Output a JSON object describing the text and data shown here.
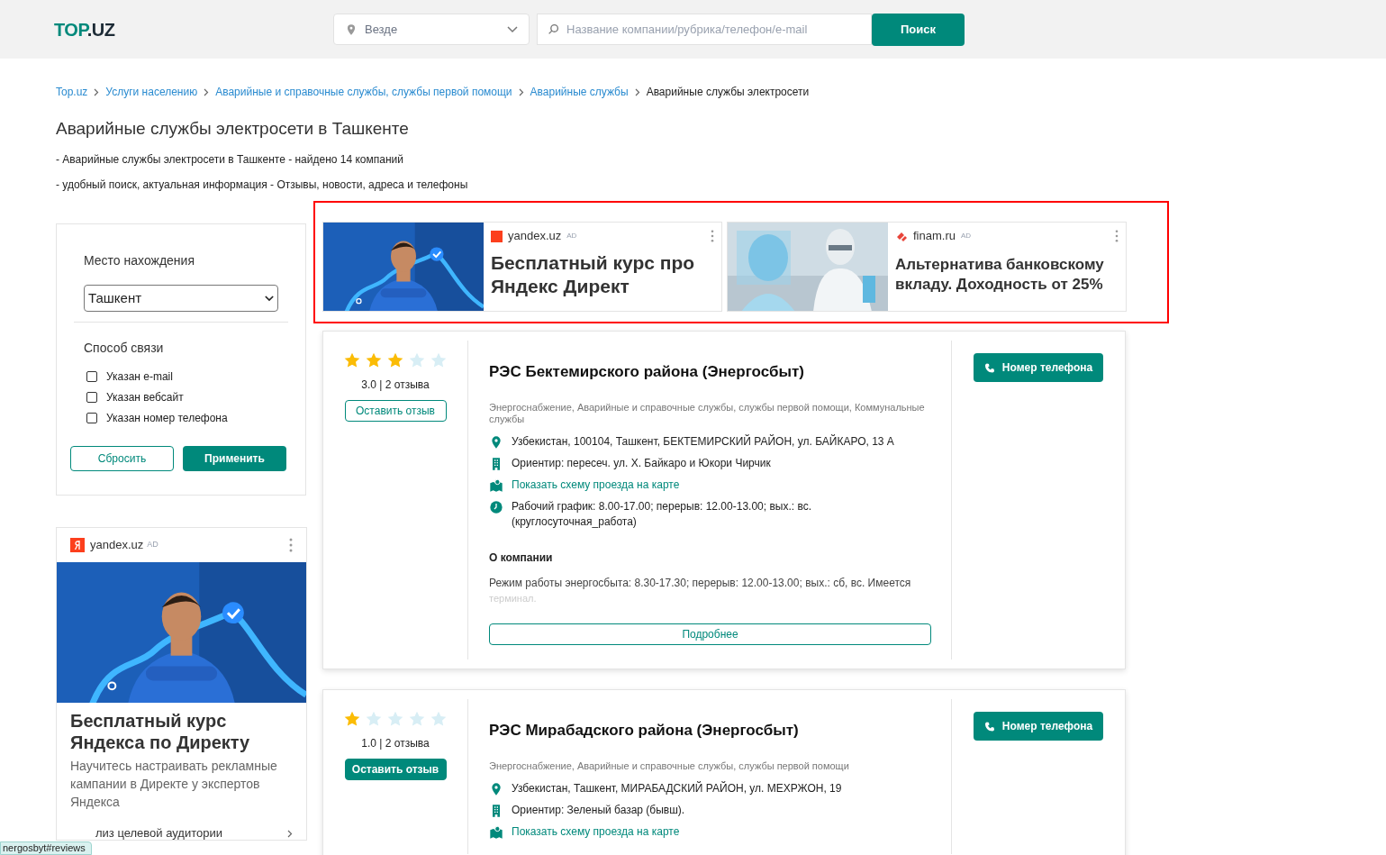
{
  "header": {
    "logo": {
      "main": "TOP",
      "accent": ".UZ"
    },
    "location": {
      "value": "Везде"
    },
    "search": {
      "placeholder": "Название компании/рубрика/телефон/e-mail"
    },
    "search_button": "Поиск"
  },
  "breadcrumbs": [
    {
      "label": "Top.uz",
      "current": false
    },
    {
      "label": "Услуги населению",
      "current": false
    },
    {
      "label": "Аварийные и справочные службы, службы первой помощи",
      "current": false
    },
    {
      "label": "Аварийные службы",
      "current": false
    },
    {
      "label": "Аварийные службы электросети",
      "current": true
    }
  ],
  "page_title": "Аварийные службы электросети в Ташкенте",
  "intro": [
    "- Аварийные службы электросети в Ташкенте - найдено 14 компаний",
    "- удобный поиск, актуальная информация - Отзывы, новости, адреса и телефоны"
  ],
  "filter": {
    "location_label": "Место нахождения",
    "location_value": "Ташкент",
    "contact_label": "Способ связи",
    "options": [
      {
        "label": "Указан e-mail",
        "checked": false
      },
      {
        "label": "Указан вебсайт",
        "checked": false
      },
      {
        "label": "Указан номер телефона",
        "checked": false
      }
    ],
    "reset": "Сбросить",
    "apply": "Применить"
  },
  "side_ad": {
    "source": "yandex.uz",
    "ad": "AD",
    "title": "Бесплатный курс Яндекса по Директу",
    "text": "Научитесь настраивать рекламные кампании в Директе у экспертов Яндекса",
    "link": "лиз целевой аудитории"
  },
  "top_ads": [
    {
      "source": "yandex.uz",
      "ad": "AD",
      "title": "Бесплатный курс про Яндекс Директ",
      "kind": "yandex"
    },
    {
      "source": "finam.ru",
      "ad": "AD",
      "title": "Альтернатива банковскому вкладу. Доходность от 25%",
      "kind": "finam"
    }
  ],
  "companies": [
    {
      "stars": 3,
      "rating": "3.0 | 2 отзыва",
      "review_button": "Оставить отзыв",
      "review_highlighted": false,
      "name": "РЭС Бектемирского района (Энергосбыт)",
      "categories": "Энергоснабжение, Аварийные и справочные службы, службы первой помощи, Коммунальные службы",
      "details": [
        {
          "kind": "address",
          "text": "Узбекистан, 100104, Ташкент, БЕКТЕМИРСКИЙ РАЙОН, ул. БАЙКАРО, 13 А"
        },
        {
          "kind": "landmark",
          "text": "Ориентир: пересеч. ул. Х. Байкаро и Юкори Чирчик"
        },
        {
          "kind": "map",
          "text": "Показать схему проезда на карте"
        },
        {
          "kind": "schedule",
          "text": "Рабочий график: 8.00-17.00; перерыв: 12.00-13.00; вых.: вс. (круглосуточная_работа)"
        }
      ],
      "about_title": "О компании",
      "about_text": "Режим работы энергосбыта: 8.30-17.30; перерыв: 12.00-13.00; вых.: сб, вс. Имеется",
      "about_faded": "терминал.",
      "more": "Подробнее",
      "phone_button": "Номер телефона"
    },
    {
      "stars": 1,
      "rating": "1.0 | 2 отзыва",
      "review_button": "Оставить отзыв",
      "review_highlighted": true,
      "name": "РЭС Мирабадского района (Энергосбыт)",
      "categories": "Энергоснабжение, Аварийные и справочные службы, службы первой помощи",
      "details": [
        {
          "kind": "address",
          "text": "Узбекистан, Ташкент, МИРАБАДСКИЙ РАЙОН, ул. МЕХРЖОН, 19"
        },
        {
          "kind": "landmark",
          "text": "Ориентир: Зеленый базар (бывш)."
        },
        {
          "kind": "map",
          "text": "Показать схему проезда на карте"
        }
      ],
      "phone_button": "Номер телефона"
    }
  ],
  "status_link": "nergosbyt#reviews"
}
